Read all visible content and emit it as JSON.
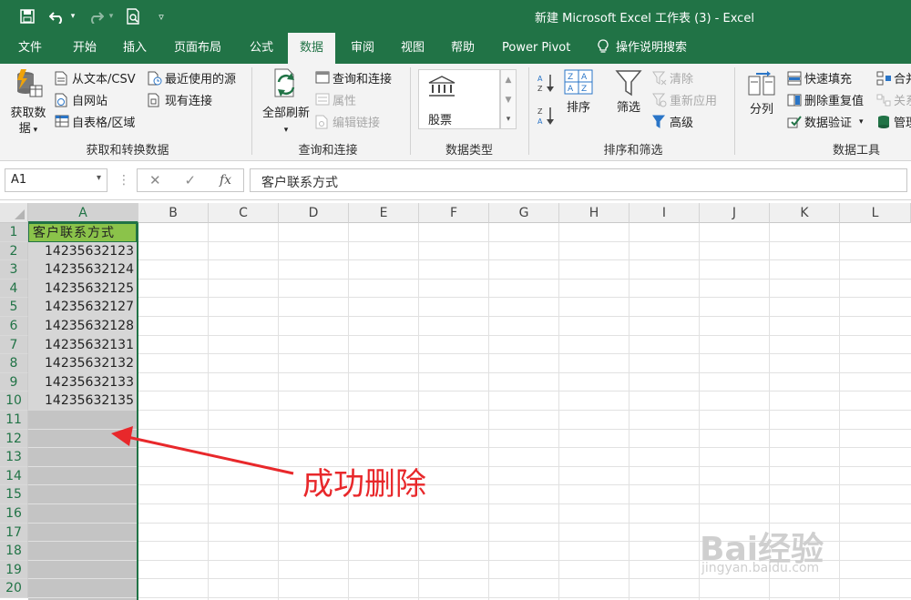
{
  "window": {
    "title": "新建 Microsoft Excel 工作表 (3)  -  Excel"
  },
  "quick_access": {
    "icons": [
      "save-icon",
      "undo-icon",
      "redo-icon",
      "print-preview-icon",
      "customize-icon"
    ]
  },
  "tabs": [
    {
      "label": "文件"
    },
    {
      "label": "开始"
    },
    {
      "label": "插入"
    },
    {
      "label": "页面布局"
    },
    {
      "label": "公式"
    },
    {
      "label": "数据"
    },
    {
      "label": "审阅"
    },
    {
      "label": "视图"
    },
    {
      "label": "帮助"
    },
    {
      "label": "Power Pivot"
    },
    {
      "label": "操作说明搜索"
    }
  ],
  "ribbon": {
    "get_data": {
      "label": "获取数\n据",
      "from_csv": "从文本/CSV",
      "from_web": "自网站",
      "from_table": "自表格/区域",
      "recent": "最近使用的源",
      "existing": "现有连接",
      "group": "获取和转换数据"
    },
    "queries": {
      "refresh_all": "全部刷新",
      "queries_connections": "查询和连接",
      "properties": "属性",
      "edit_links": "编辑链接",
      "group": "查询和连接"
    },
    "data_types": {
      "stocks": "股票",
      "group": "数据类型"
    },
    "sort_filter": {
      "sort": "排序",
      "filter": "筛选",
      "clear": "清除",
      "reapply": "重新应用",
      "advanced": "高级",
      "group": "排序和筛选"
    },
    "data_tools": {
      "text_to_columns": "分列",
      "flash_fill": "快速填充",
      "remove_duplicates": "删除重复值",
      "data_validation": "数据验证",
      "consolidate": "合并",
      "relationships": "关系",
      "manage": "管理",
      "group": "数据工具"
    }
  },
  "formula_bar": {
    "name_box": "A1",
    "formula": "客户联系方式"
  },
  "sheet": {
    "columns": [
      "A",
      "B",
      "C",
      "D",
      "E",
      "F",
      "G",
      "H",
      "I",
      "J",
      "K",
      "L"
    ],
    "rows": [
      "1",
      "2",
      "3",
      "4",
      "5",
      "6",
      "7",
      "8",
      "9",
      "10",
      "11",
      "12",
      "13",
      "14",
      "15",
      "16",
      "17",
      "18",
      "19",
      "20"
    ],
    "cells": [
      "客户联系方式",
      "14235632123",
      "14235632124",
      "14235632125",
      "14235632127",
      "14235632128",
      "14235632131",
      "14235632132",
      "14235632133",
      "14235632135"
    ]
  },
  "annotation": "成功删除",
  "watermark": {
    "text": "Bai经验",
    "url": "jingyan.baidu.com"
  },
  "colors": {
    "excel_green": "#217346",
    "header_fill": "#8bc34a",
    "annotation_red": "#e8282b"
  }
}
